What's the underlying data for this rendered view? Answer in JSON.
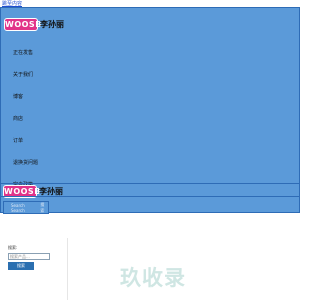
{
  "header": {
    "skip_link": "跳至内容",
    "brand_logo": "WOOSB",
    "brand_name": "李孙丽"
  },
  "nav": {
    "items": [
      {
        "label": "正在发售"
      },
      {
        "label": "关于我们"
      },
      {
        "label": "博客"
      },
      {
        "label": "商店"
      },
      {
        "label": "订单"
      },
      {
        "label": "退换货问题"
      },
      {
        "label": "客户政策"
      }
    ]
  },
  "header_search": {
    "placeholder": "Search Search",
    "button_label": "搜索"
  },
  "search": {
    "label": "搜索:",
    "placeholder": "搜索产品...",
    "button_label": "搜索"
  },
  "watermark": "玖收录",
  "colors": {
    "panel": "#5b9ad9",
    "logo": "#e23389",
    "button": "#2b6fb0"
  }
}
